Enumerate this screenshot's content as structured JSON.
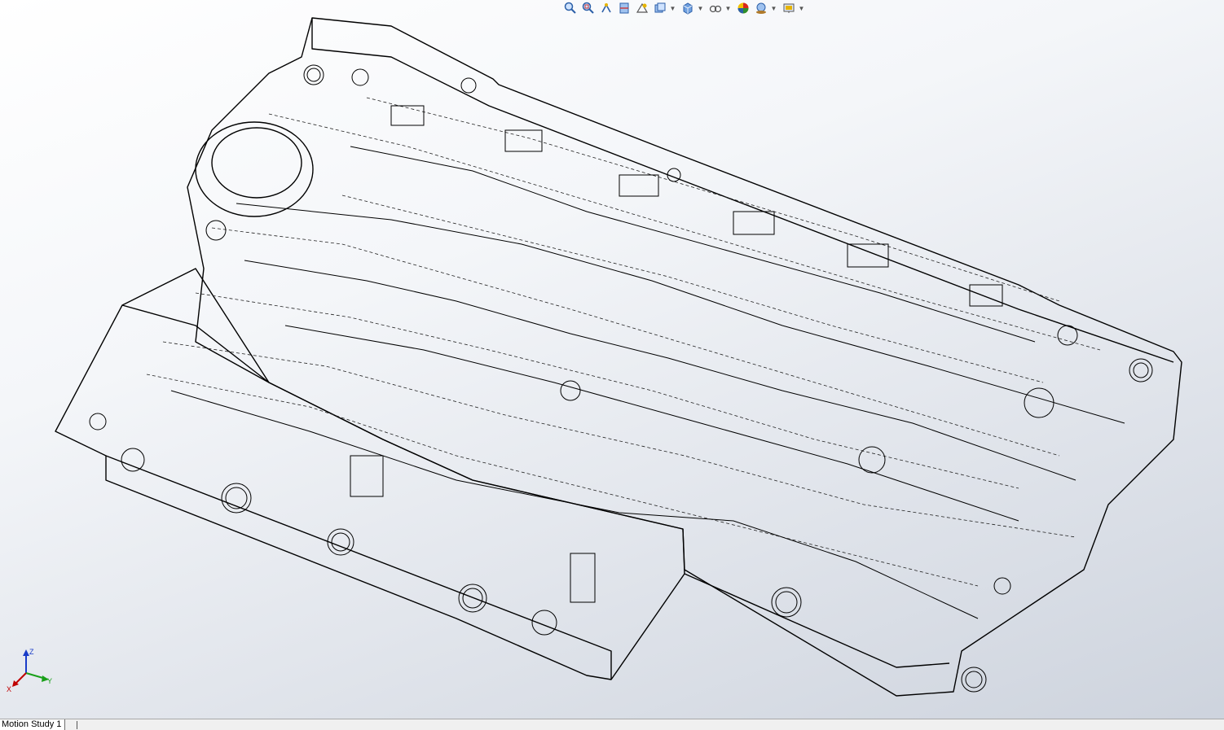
{
  "window": {
    "title": ""
  },
  "heads_up_toolbar": [
    {
      "name": "zoom-to-fit-icon",
      "tooltip": ""
    },
    {
      "name": "zoom-to-area-icon",
      "tooltip": ""
    },
    {
      "name": "previous-view-icon",
      "tooltip": ""
    },
    {
      "name": "section-view-icon",
      "tooltip": ""
    },
    {
      "name": "dynamic-annotation-icon",
      "tooltip": ""
    },
    {
      "name": "view-orientation-icon",
      "has_dropdown": true
    },
    {
      "name": "display-style-icon",
      "has_dropdown": true
    },
    {
      "name": "hide-show-items-icon",
      "has_dropdown": true
    },
    {
      "name": "edit-appearance-icon"
    },
    {
      "name": "apply-scene-icon",
      "has_dropdown": true
    },
    {
      "name": "view-settings-icon",
      "has_dropdown": true
    }
  ],
  "triad": {
    "x": "X",
    "y": "Y",
    "z": "Z"
  },
  "bottom_tabs": [
    {
      "label": "Motion Study 1",
      "active": true
    }
  ],
  "colors": {
    "model_lines": "#000000",
    "hidden_lines": "#333333",
    "background_top": "#ffffff",
    "background_bottom": "#cdd3dd",
    "triad_x": "#c00000",
    "triad_y": "#1aa01a",
    "triad_z": "#1a3cc8"
  }
}
